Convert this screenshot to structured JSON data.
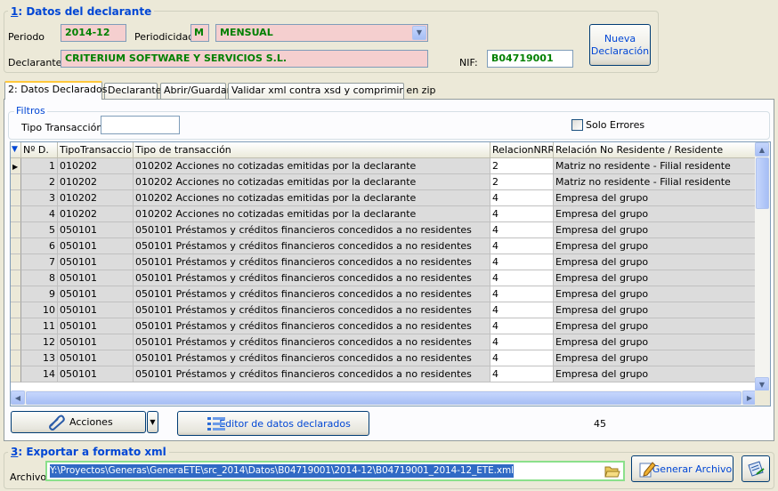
{
  "declarant": {
    "group_num": "1",
    "group_title": ": Datos del declarante",
    "periodo_label": "Periodo",
    "periodo_value": "2014-12",
    "periodicidad_label": "Periodicidad",
    "periodicidad_code": "M",
    "periodicidad_value": "MENSUAL",
    "declarante_label": "Declarante:",
    "declarante_value": "CRITERIUM SOFTWARE Y SERVICIOS S.L.",
    "nif_label": "NIF:",
    "nif_value": "B04719001",
    "nueva_line1": "Nueva",
    "nueva_line2": "Declaración"
  },
  "tabs": [
    {
      "label": "2: Datos Declarados"
    },
    {
      "label": "Declarante"
    },
    {
      "label": "Abrir/Guardar"
    },
    {
      "label": "Validar xml contra xsd y comprimir en zip"
    }
  ],
  "filters": {
    "title": "Filtros",
    "tipo_label": "Tipo Transacción",
    "tipo_value": "",
    "solo_errores_label": "Solo Errores"
  },
  "grid": {
    "headers": [
      "Nº D.",
      "TipoTransaccion",
      "Tipo de transacción",
      "RelacionNRR",
      "Relación No Residente / Residente"
    ],
    "rows": [
      {
        "n": "1",
        "tipo": "010202",
        "desc": "010202 Acciones no cotizadas emitidas por la declarante",
        "rel": "2",
        "reldesc": "Matriz no residente - Filial residente"
      },
      {
        "n": "2",
        "tipo": "010202",
        "desc": "010202 Acciones no cotizadas emitidas por la declarante",
        "rel": "2",
        "reldesc": "Matriz no residente - Filial residente"
      },
      {
        "n": "3",
        "tipo": "010202",
        "desc": "010202 Acciones no cotizadas emitidas por la declarante",
        "rel": "4",
        "reldesc": "Empresa del grupo"
      },
      {
        "n": "4",
        "tipo": "010202",
        "desc": "010202 Acciones no cotizadas emitidas por la declarante",
        "rel": "4",
        "reldesc": "Empresa del grupo"
      },
      {
        "n": "5",
        "tipo": "050101",
        "desc": "050101 Préstamos y créditos financieros concedidos a no residentes",
        "rel": "4",
        "reldesc": "Empresa del grupo"
      },
      {
        "n": "6",
        "tipo": "050101",
        "desc": "050101 Préstamos y créditos financieros concedidos a no residentes",
        "rel": "4",
        "reldesc": "Empresa del grupo"
      },
      {
        "n": "7",
        "tipo": "050101",
        "desc": "050101 Préstamos y créditos financieros concedidos a no residentes",
        "rel": "4",
        "reldesc": "Empresa del grupo"
      },
      {
        "n": "8",
        "tipo": "050101",
        "desc": "050101 Préstamos y créditos financieros concedidos a no residentes",
        "rel": "4",
        "reldesc": "Empresa del grupo"
      },
      {
        "n": "9",
        "tipo": "050101",
        "desc": "050101 Préstamos y créditos financieros concedidos a no residentes",
        "rel": "4",
        "reldesc": "Empresa del grupo"
      },
      {
        "n": "10",
        "tipo": "050101",
        "desc": "050101 Préstamos y créditos financieros concedidos a no residentes",
        "rel": "4",
        "reldesc": "Empresa del grupo"
      },
      {
        "n": "11",
        "tipo": "050101",
        "desc": "050101 Préstamos y créditos financieros concedidos a no residentes",
        "rel": "4",
        "reldesc": "Empresa del grupo"
      },
      {
        "n": "12",
        "tipo": "050101",
        "desc": "050101 Préstamos y créditos financieros concedidos a no residentes",
        "rel": "4",
        "reldesc": "Empresa del grupo"
      },
      {
        "n": "13",
        "tipo": "050101",
        "desc": "050101 Préstamos y créditos financieros concedidos a no residentes",
        "rel": "4",
        "reldesc": "Empresa del grupo"
      },
      {
        "n": "14",
        "tipo": "050101",
        "desc": "050101 Préstamos y créditos financieros concedidos a no residentes",
        "rel": "4",
        "reldesc": "Empresa del grupo"
      }
    ]
  },
  "actions": {
    "acciones_label": "Acciones",
    "editor_label": "Editor de datos declarados",
    "count": "45"
  },
  "export": {
    "group_num": "3",
    "group_title": ": Exportar a formato xml",
    "archivo_label": "Archivo",
    "archivo_value": "Y:\\Proyectos\\Generas\\GeneraETE\\src_2014\\Datos\\B04719001\\2014-12\\B04719001_2014-12_ETE.xml",
    "generar_label": "Generar Archivo"
  }
}
